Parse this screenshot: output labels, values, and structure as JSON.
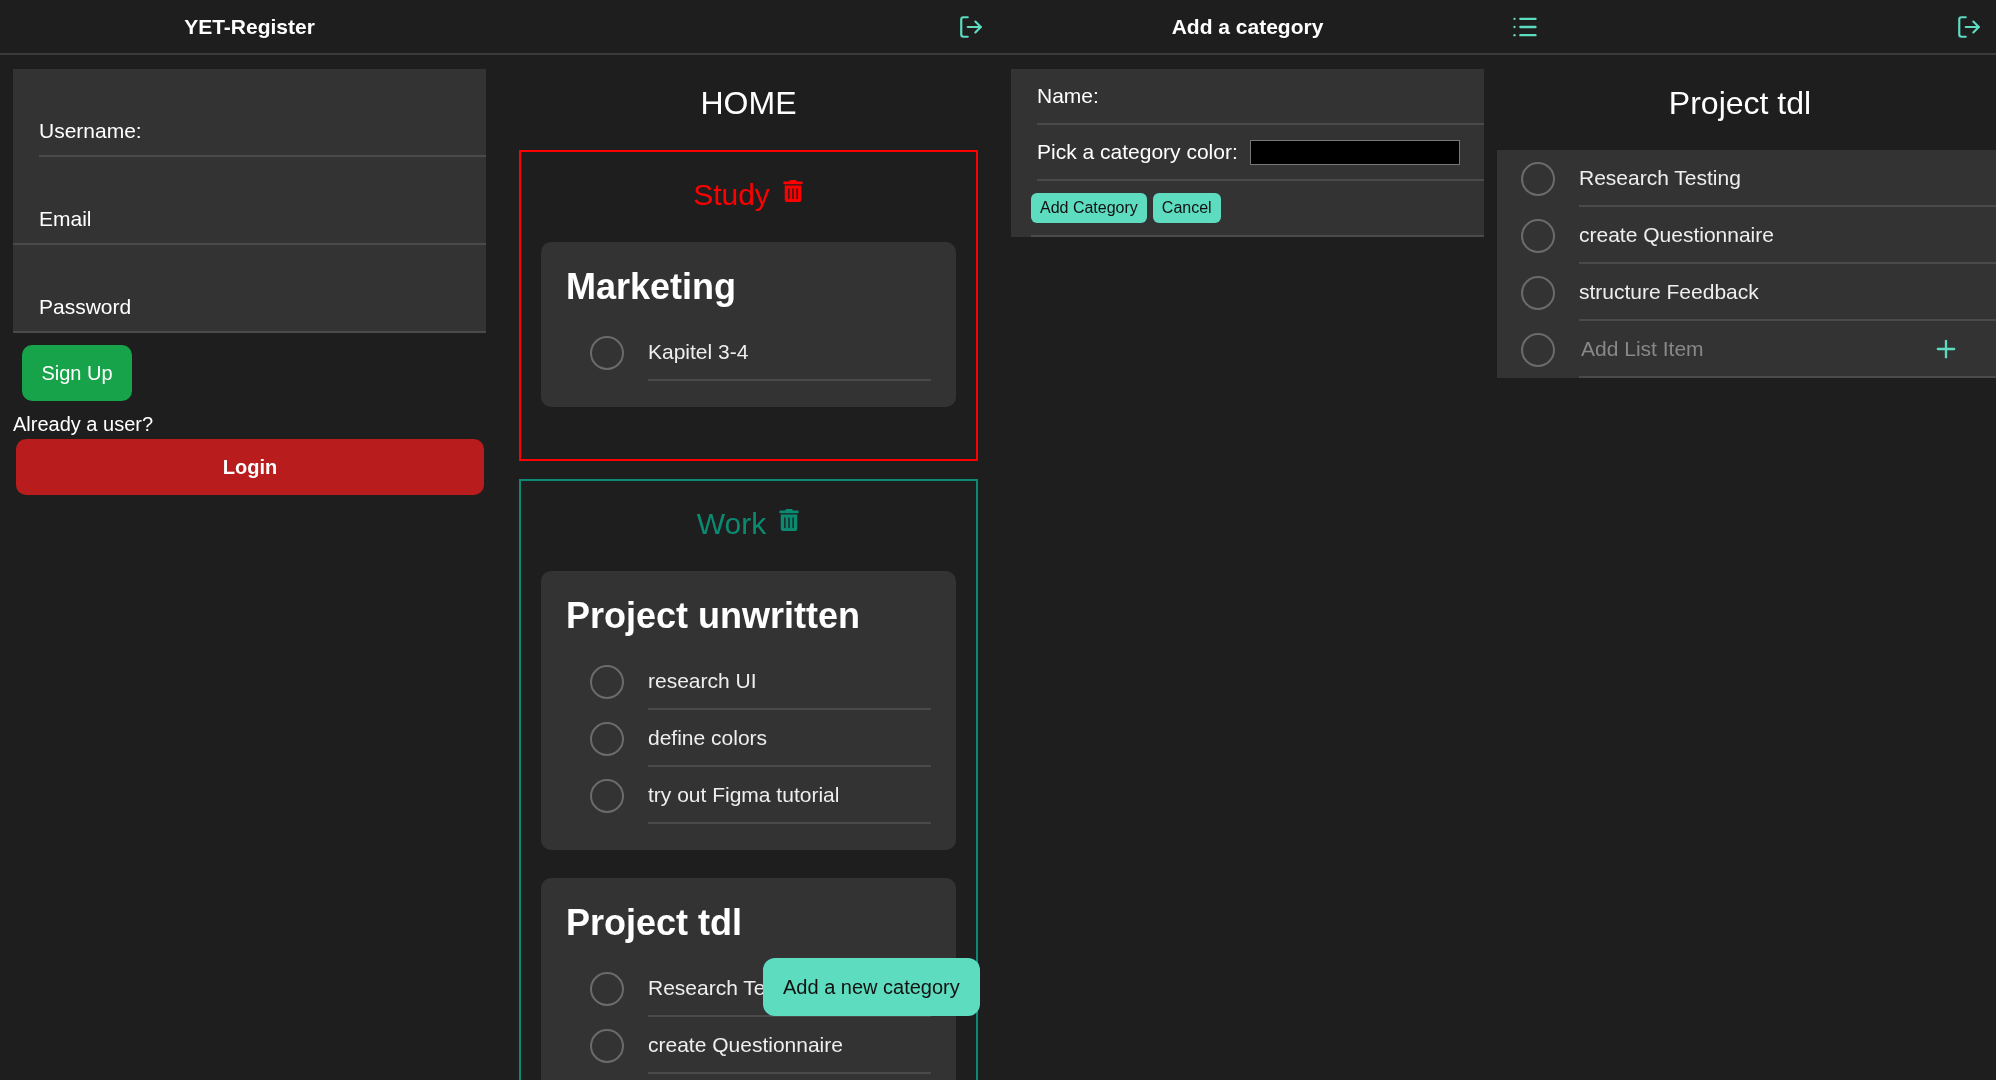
{
  "headers": [
    {
      "title": "YET-Register",
      "icons": [
        {
          "kind": "logout"
        }
      ]
    },
    {
      "title": "Add a category",
      "icons": [
        {
          "kind": "list"
        },
        {
          "kind": "logout"
        }
      ]
    }
  ],
  "register": {
    "fields": [
      {
        "kind": "label",
        "text": "Username:"
      },
      {
        "kind": "input",
        "placeholder": "Email"
      },
      {
        "kind": "input",
        "placeholder": "Password"
      }
    ],
    "signup_button": "Sign Up",
    "login_prompt": "Already a user?",
    "login_button": "Login"
  },
  "home": {
    "title": "HOME",
    "categories": [
      {
        "name": "Study",
        "color": "#ff0000",
        "lists": [
          {
            "title": "Marketing",
            "tasks": [
              {
                "text": "Kapitel 3-4",
                "checked": false
              }
            ]
          }
        ]
      },
      {
        "name": "Work",
        "color": "#0b8a72",
        "lists": [
          {
            "title": "Project unwritten",
            "tasks": [
              {
                "text": "research UI",
                "checked": false
              },
              {
                "text": "define colors",
                "checked": false
              },
              {
                "text": "try out Figma tutorial",
                "checked": false
              }
            ]
          },
          {
            "title": "Project tdl",
            "tasks": [
              {
                "text": "Research Te",
                "checked": false
              },
              {
                "text": "create Questionnaire",
                "checked": false
              }
            ]
          }
        ]
      }
    ],
    "add_button": "Add a new category"
  },
  "add_category": {
    "name_label": "Name:",
    "color_label": "Pick a category color:",
    "buttons": [
      "Add Category",
      "Cancel"
    ]
  },
  "list_detail": {
    "title": "Project tdl",
    "tasks": [
      {
        "text": "Research Testing",
        "checked": false
      },
      {
        "text": "create Questionnaire",
        "checked": false
      },
      {
        "text": "structure Feedback",
        "checked": false
      }
    ],
    "add_item": {
      "placeholder": "Add List Item",
      "checked": false
    }
  }
}
